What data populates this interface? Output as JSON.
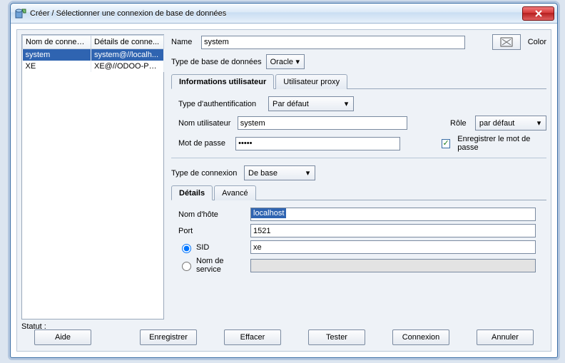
{
  "window": {
    "title": "Créer / Sélectionner une connexion de base de données"
  },
  "list": {
    "columns": [
      "Nom de connexion",
      "Détails de conne..."
    ],
    "rows": [
      {
        "name": "system",
        "details": "system@//localh..."
      },
      {
        "name": "XE",
        "details": "XE@//ODOO-PC:..."
      }
    ]
  },
  "form": {
    "name_label": "Name",
    "name_value": "system",
    "color_label": "Color",
    "dbtype_label": "Type de base de données",
    "dbtype_value": "Oracle",
    "tabs_user": [
      "Informations utilisateur",
      "Utilisateur proxy"
    ],
    "auth_label": "Type d'authentification",
    "auth_value": "Par défaut",
    "user_label": "Nom utilisateur",
    "user_value": "system",
    "pass_label": "Mot de passe",
    "pass_value": "•••••",
    "role_label": "Rôle",
    "role_value": "par défaut",
    "savepass_label": "Enregistrer le mot de passe",
    "conntype_label": "Type de connexion",
    "conntype_value": "De base",
    "tabs_conn": [
      "Détails",
      "Avancé"
    ],
    "host_label": "Nom d'hôte",
    "host_value": "localhost",
    "port_label": "Port",
    "port_value": "1521",
    "sid_label": "SID",
    "sid_value": "xe",
    "svc_label": "Nom de service"
  },
  "status_label": "Statut :",
  "buttons": {
    "help": "Aide",
    "save": "Enregistrer",
    "clear": "Effacer",
    "test": "Tester",
    "connect": "Connexion",
    "cancel": "Annuler"
  }
}
